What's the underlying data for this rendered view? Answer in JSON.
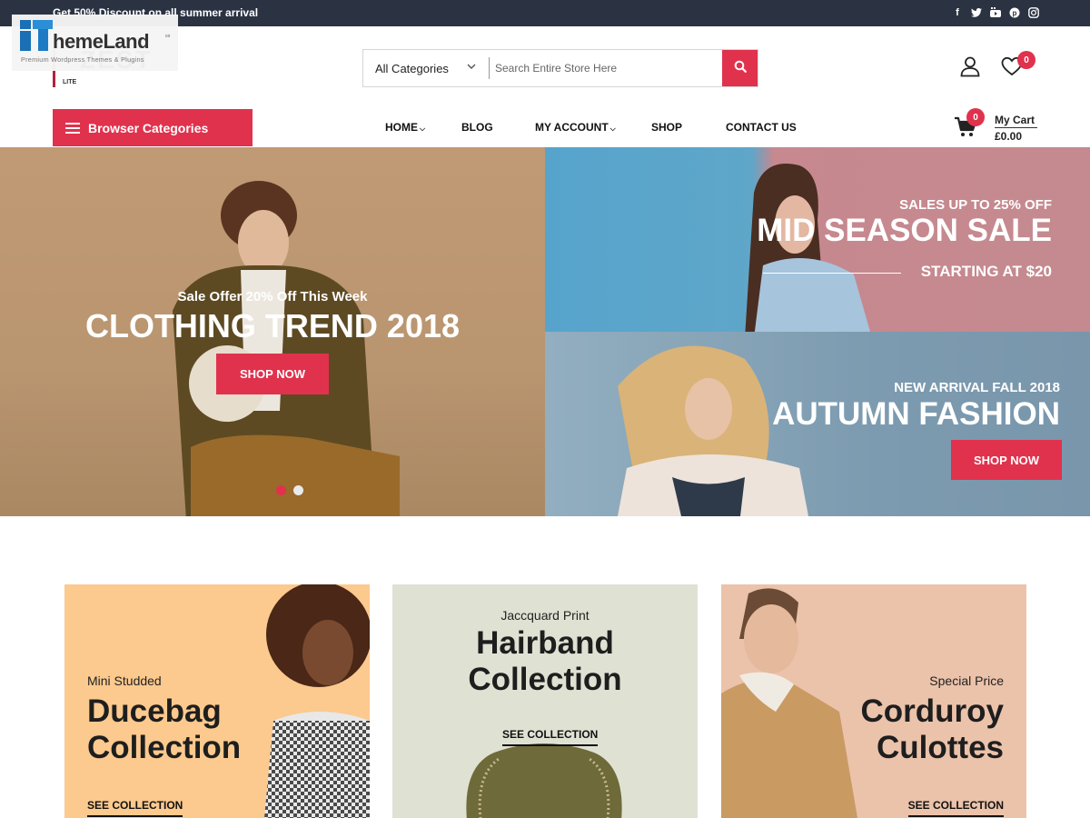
{
  "topbar": {
    "promo": "Get 50% Discount on all summer arrival",
    "social": [
      {
        "icon": "facebook-icon",
        "glyph": "f"
      },
      {
        "icon": "twitter-icon",
        "glyph": "t"
      },
      {
        "icon": "youtube-icon",
        "glyph": "▶"
      },
      {
        "icon": "pinterest-icon",
        "glyph": "p"
      },
      {
        "icon": "instagram-icon",
        "glyph": "◎"
      }
    ]
  },
  "logo": {
    "text": "ZEST",
    "badge": "LITE"
  },
  "watermark": {
    "brand": "hemeLand",
    "suffix": "co",
    "tagline": "Premium Wordpress Themes & Plugins"
  },
  "search": {
    "category": "All Categories",
    "placeholder": "Search Entire Store Here"
  },
  "header": {
    "wishlist_count": "0",
    "cart_count": "0",
    "cart_label": "My Cart",
    "cart_total": "£0.00"
  },
  "nav": {
    "browse_label": "Browser Categories",
    "items": [
      {
        "label": "HOME",
        "dropdown": true
      },
      {
        "label": "BLOG",
        "dropdown": false
      },
      {
        "label": "MY ACCOUNT",
        "dropdown": true
      },
      {
        "label": "SHOP",
        "dropdown": false
      },
      {
        "label": "CONTACT US",
        "dropdown": false
      }
    ]
  },
  "hero": {
    "main": {
      "subtitle": "Sale Offer 20% Off This Week",
      "title": "CLOTHING TREND 2018",
      "button": "SHOP NOW",
      "slides": 2,
      "active_slide": 1
    },
    "top_right": {
      "subtitle": "SALES UP TO 25% OFF",
      "title": "MID SEASON SALE",
      "tagline": "STARTING AT $20"
    },
    "bottom_right": {
      "subtitle": "NEW ARRIVAL FALL 2018",
      "title": "AUTUMN FASHION",
      "button": "SHOP NOW"
    }
  },
  "collections": [
    {
      "subtitle": "Mini Studded",
      "title_line1": "Ducebag",
      "title_line2": "Collection",
      "link": "SEE COLLECTION"
    },
    {
      "subtitle": "Jaccquard Print",
      "title_line1": "Hairband",
      "title_line2": "Collection",
      "link": "SEE COLLECTION"
    },
    {
      "subtitle": "Special Price",
      "title_line1": "Corduroy",
      "title_line2": "Culottes",
      "link": "SEE COLLECTION"
    }
  ],
  "colors": {
    "accent": "#e0324d",
    "topbar": "#2b3343"
  }
}
